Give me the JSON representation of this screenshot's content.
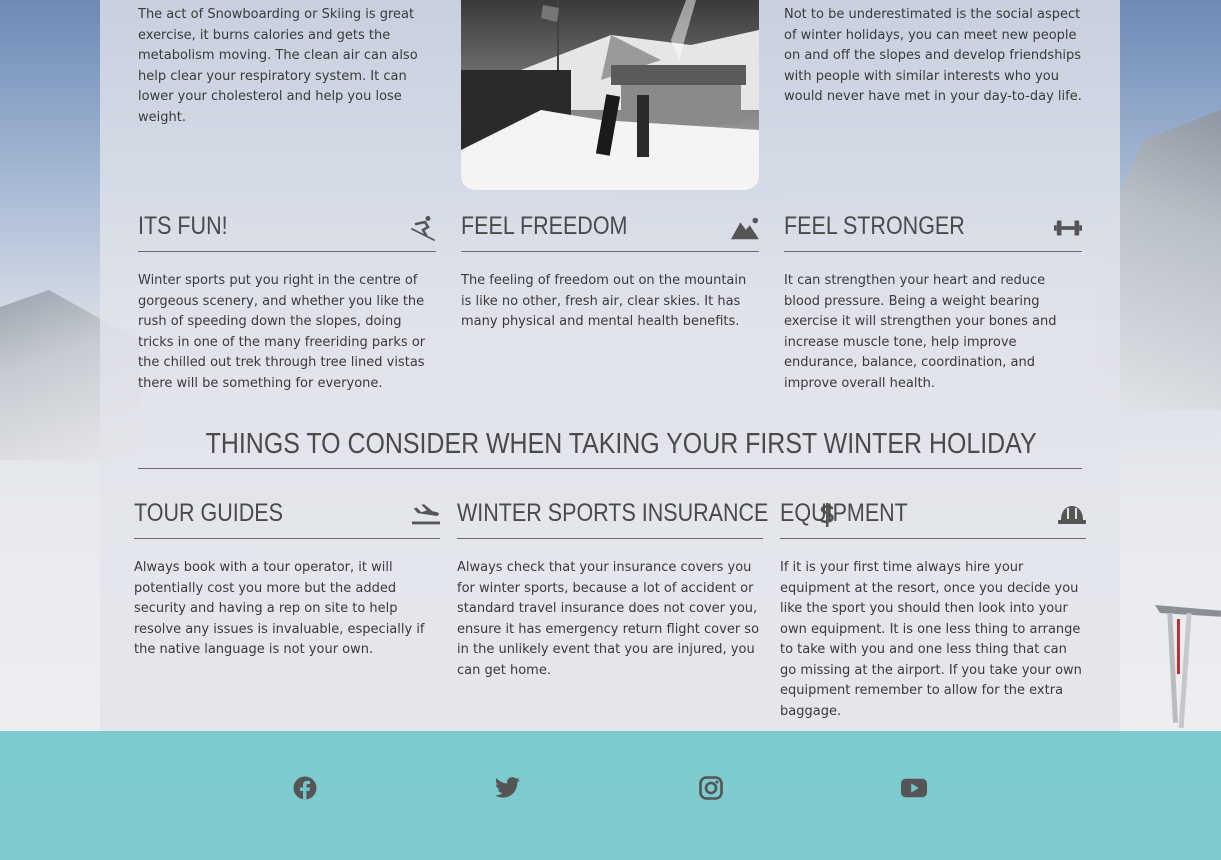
{
  "intro": {
    "left_text": "The act of Snowboarding or Skiing is great exercise, it burns calories and gets the metabolism moving. The clean air can also help clear your respiratory system. It can lower your cholesterol and help you lose weight.",
    "right_text": "Not to be underestimated is the social aspect of winter holidays, you can meet new people on and off the slopes and develop friendships with people with similar interests who you would never have met in your day-to-day life."
  },
  "benefits": [
    {
      "title": "ITS FUN!",
      "icon": "skiing-icon",
      "text": "Winter sports put you right in the centre of gorgeous scenery, and whether you like the rush of speeding down the slopes, doing tricks in one of the many freeriding parks or the chilled out trek through tree lined vistas there will be something for everyone."
    },
    {
      "title": "FEEL FREEDOM",
      "icon": "mountain-icon",
      "text": "The feeling of freedom out on the mountain is like no other, fresh air, clear skies. It has many physical and mental health benefits."
    },
    {
      "title": "FEEL STRONGER",
      "icon": "dumbbell-icon",
      "text": "It can strengthen your heart and reduce blood pressure. Being a weight bearing exercise it will strengthen your bones and increase muscle tone, help improve endurance, balance, coordination, and improve overall health."
    }
  ],
  "consider": {
    "title": "THINGS TO CONSIDER WHEN TAKING YOUR FIRST WINTER HOLIDAY",
    "items": [
      {
        "title": "TOUR GUIDES",
        "icon": "plane-landing-icon",
        "text": "Always book with a tour operator, it will potentially cost you more but the added security and having a rep on site to help resolve any issues is invaluable, especially if the native language is not your own."
      },
      {
        "title": "WINTER SPORTS INSURANCE",
        "icon": "dollar-icon",
        "text": "Always check that your insurance covers you for winter sports, because a lot of accident or standard travel insurance does not cover you, ensure it has emergency return flight cover so in the unlikely event that you are injured, you can get home."
      },
      {
        "title": "EQUIPMENT",
        "icon": "helmet-icon",
        "text": "If it is your first time always hire your equipment at the resort, once you decide you like the sport you should then look into your own equipment. It is one less thing to arrange to take with you and one less thing that can go missing at the airport. If you take your own equipment remember to allow for the extra baggage."
      }
    ]
  },
  "footer": {
    "social": [
      "facebook-icon",
      "twitter-icon",
      "instagram-icon",
      "youtube-icon"
    ]
  },
  "colors": {
    "footer_bg": "#68c4c9",
    "heading": "#4a4a4a",
    "text": "#3a3a3a"
  }
}
